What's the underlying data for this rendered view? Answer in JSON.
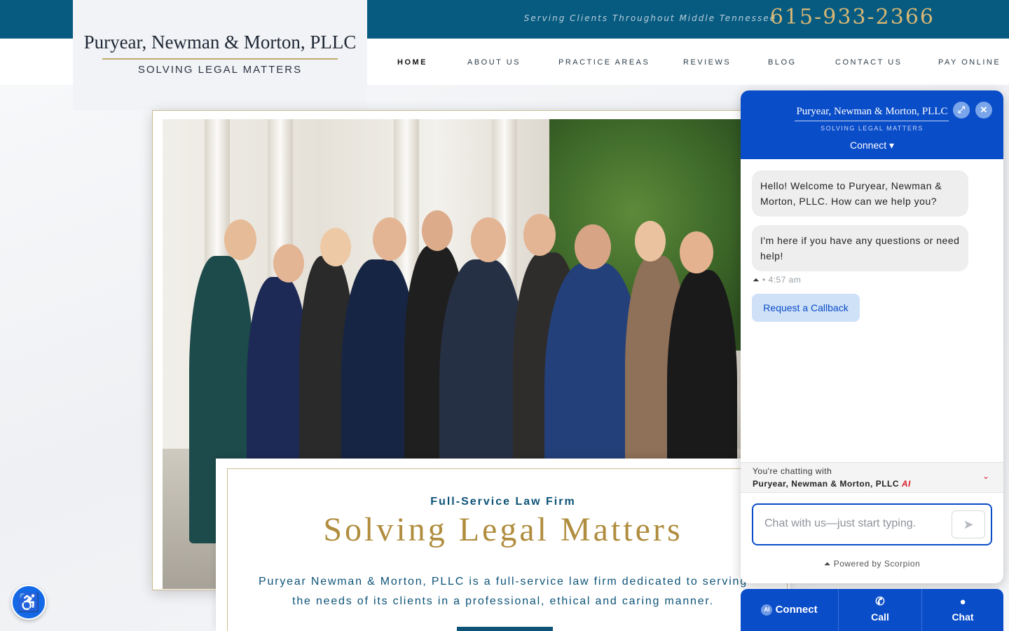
{
  "topbar": {
    "serving": "Serving Clients Throughout Middle Tennessee",
    "phone": "615-933-2366"
  },
  "logo": {
    "name": "Puryear, Newman & Morton, PLLC",
    "tagline": "SOLVING LEGAL MATTERS"
  },
  "nav": {
    "items": [
      {
        "label": "HOME",
        "active": true
      },
      {
        "label": "ABOUT US"
      },
      {
        "label": "PRACTICE AREAS"
      },
      {
        "label": "REVIEWS"
      },
      {
        "label": "BLOG"
      },
      {
        "label": "CONTACT US"
      },
      {
        "label": "PAY ONLINE"
      }
    ]
  },
  "hero": {
    "eyebrow": "Full-Service Law Firm",
    "headline": "Solving Legal Matters",
    "description": "Puryear Newman & Morton, PLLC is a full-service law firm dedicated to serving the needs of its clients in a professional, ethical and caring manner."
  },
  "chat": {
    "firm_name": "Puryear, Newman & Morton, PLLC",
    "tagline": "SOLVING LEGAL MATTERS",
    "connect_label": "Connect ▾",
    "messages": [
      "Hello! Welcome to Puryear, Newman & Morton, PLLC. How can we help you?",
      "I'm here if you have any questions or need help!"
    ],
    "timestamp": "• 4:57 am",
    "callback_label": "Request a Callback",
    "chatting_with_label": "You're chatting with",
    "chatting_with_name": "Puryear, Newman & Morton, PLLC",
    "ai_badge": "AI",
    "input_placeholder": "Chat with us—just start typing.",
    "powered_by": "Powered by Scorpion"
  },
  "actionbar": {
    "connect": "Connect",
    "call": "Call",
    "chat": "Chat"
  },
  "colors": {
    "topbar": "#075a80",
    "gold": "#b08d3e",
    "chat_blue": "#0a4dc9"
  }
}
